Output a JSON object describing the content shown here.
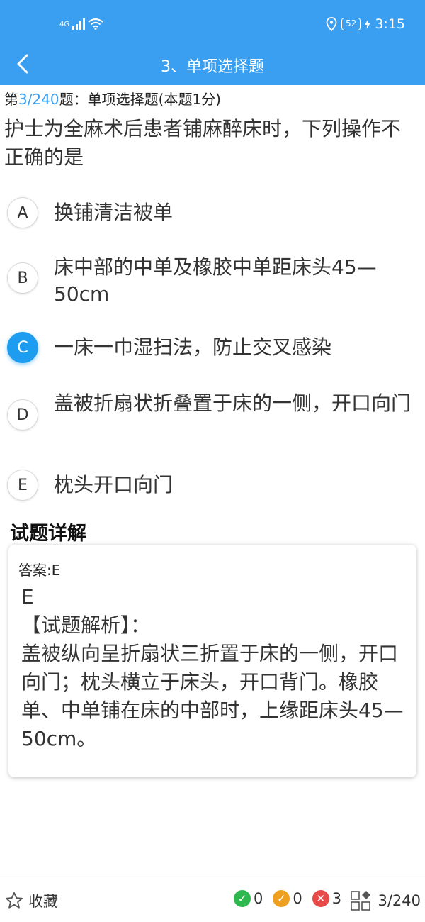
{
  "status_bar": {
    "network": "4G",
    "battery": "52",
    "time": "3:15"
  },
  "nav": {
    "title": "3、单项选择题"
  },
  "question_meta": {
    "prefix": "第",
    "current": "3/240",
    "suffix": "题：单项选择题(本题1分)"
  },
  "question": {
    "text": "护士为全麻术后患者铺麻醉床时，下列操作不正确的是"
  },
  "options": [
    {
      "letter": "A",
      "text": "换铺清洁被单",
      "selected": false
    },
    {
      "letter": "B",
      "text": "床中部的中单及橡胶中单距床头45—50cm",
      "selected": false
    },
    {
      "letter": "C",
      "text": "一床一巾湿扫法，防止交叉感染",
      "selected": true
    },
    {
      "letter": "D",
      "text": "盖被折扇状折叠置于床的一侧，开口向门",
      "selected": false
    },
    {
      "letter": "E",
      "text": "枕头开口向门",
      "selected": false
    }
  ],
  "detail": {
    "heading": "试题详解",
    "answer_label": "答案:E",
    "analysis_lines": [
      "E",
      "【试题解析】：",
      "盖被纵向呈折扇状三折置于床的一侧，开口向门；枕头横立于床头，开口背门。橡胶单、中单铺在床的中部时，上缘距床头45—50cm。"
    ]
  },
  "bottom_bar": {
    "favorite_label": "收藏",
    "correct_count": "0",
    "partial_count": "0",
    "wrong_count": "3",
    "progress": "3/240"
  },
  "colors": {
    "header": "#3a9ff0",
    "selected": "#1e9cf0",
    "correct": "#2fb84f",
    "partial": "#f0a020",
    "wrong": "#e84a4a"
  }
}
